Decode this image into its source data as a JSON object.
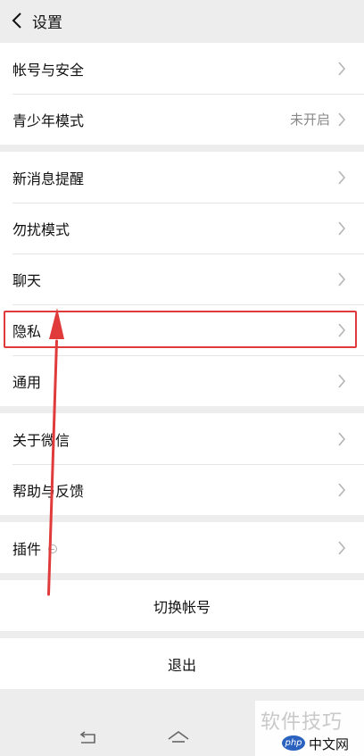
{
  "header": {
    "title": "设置"
  },
  "groups": [
    {
      "items": [
        {
          "label": "帐号与安全",
          "value": ""
        },
        {
          "label": "青少年模式",
          "value": "未开启"
        }
      ]
    },
    {
      "items": [
        {
          "label": "新消息提醒",
          "value": ""
        },
        {
          "label": "勿扰模式",
          "value": ""
        },
        {
          "label": "聊天",
          "value": ""
        },
        {
          "label": "隐私",
          "value": ""
        },
        {
          "label": "通用",
          "value": ""
        }
      ]
    },
    {
      "items": [
        {
          "label": "关于微信",
          "value": ""
        },
        {
          "label": "帮助与反馈",
          "value": ""
        }
      ]
    },
    {
      "items": [
        {
          "label": "插件",
          "value": ""
        }
      ]
    }
  ],
  "actions": {
    "switch_account": "切换帐号",
    "logout": "退出"
  },
  "annotation": {
    "color": "#e03a3a",
    "highlighted_item": "隐私"
  },
  "watermark": {
    "line1": "软件技巧",
    "logo": "php",
    "line2": "中文网"
  },
  "icons": {
    "back": "chevron-left-icon",
    "row": "chevron-right-icon",
    "plugin": "plugin-indicator-icon",
    "nav_back": "nav-back-icon",
    "nav_home": "nav-home-icon"
  }
}
